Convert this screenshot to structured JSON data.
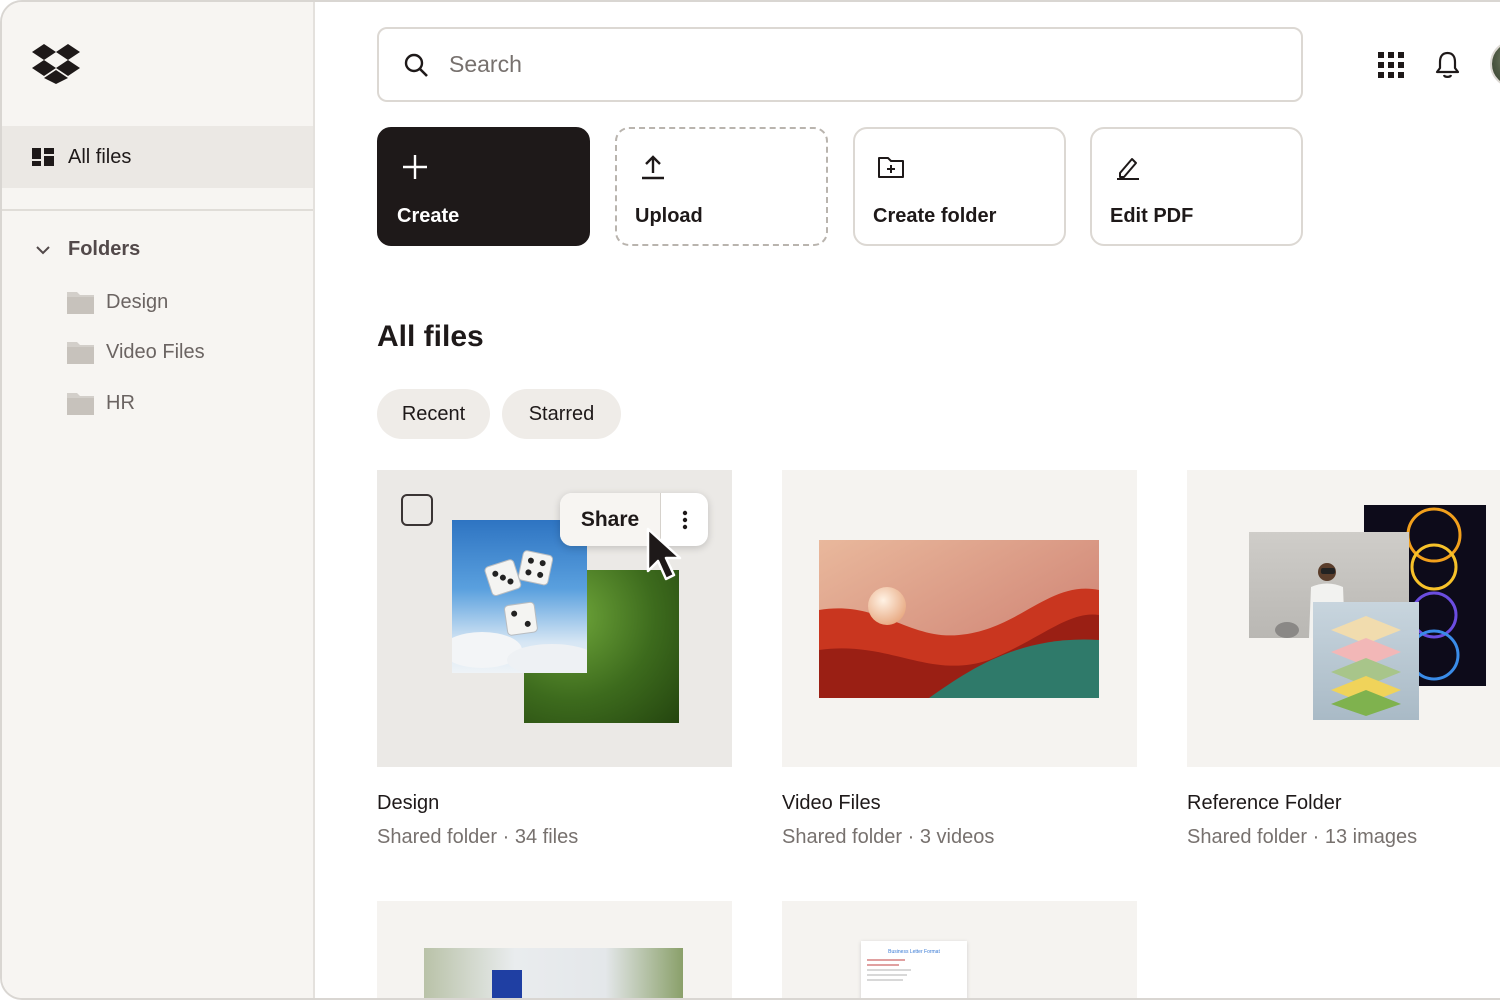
{
  "sidebar": {
    "nav_all_files": "All files",
    "folders_heading": "Folders",
    "folders": [
      {
        "label": "Design"
      },
      {
        "label": "Video Files"
      },
      {
        "label": "HR"
      }
    ]
  },
  "search": {
    "placeholder": "Search"
  },
  "actions": {
    "create": "Create",
    "upload": "Upload",
    "create_folder": "Create folder",
    "edit_pdf": "Edit PDF"
  },
  "main": {
    "title": "All files",
    "filters": [
      "Recent",
      "Starred"
    ],
    "share_label": "Share",
    "cards": [
      {
        "name": "Design",
        "meta": "Shared folder · 34 files"
      },
      {
        "name": "Video Files",
        "meta": "Shared folder · 3 videos"
      },
      {
        "name": "Reference Folder",
        "meta": "Shared folder · 13 images"
      }
    ],
    "doc_preview_title": "Business Letter Format"
  },
  "icons": {
    "logo": "dropbox-logo",
    "all_files": "grid-layout-icon",
    "folder": "folder-icon",
    "search": "search-icon",
    "apps": "apps-grid-icon",
    "notifications": "bell-icon",
    "create": "plus-icon",
    "upload": "upload-icon",
    "create_folder": "folder-plus-icon",
    "edit_pdf": "pencil-icon",
    "more": "more-vertical-icon",
    "cursor": "mouse-cursor-icon"
  },
  "colors": {
    "primary_dark": "#1e1919",
    "sidebar_bg": "#f7f5f2",
    "selected_nav_bg": "#ebe8e4",
    "muted_text": "#77716e"
  }
}
